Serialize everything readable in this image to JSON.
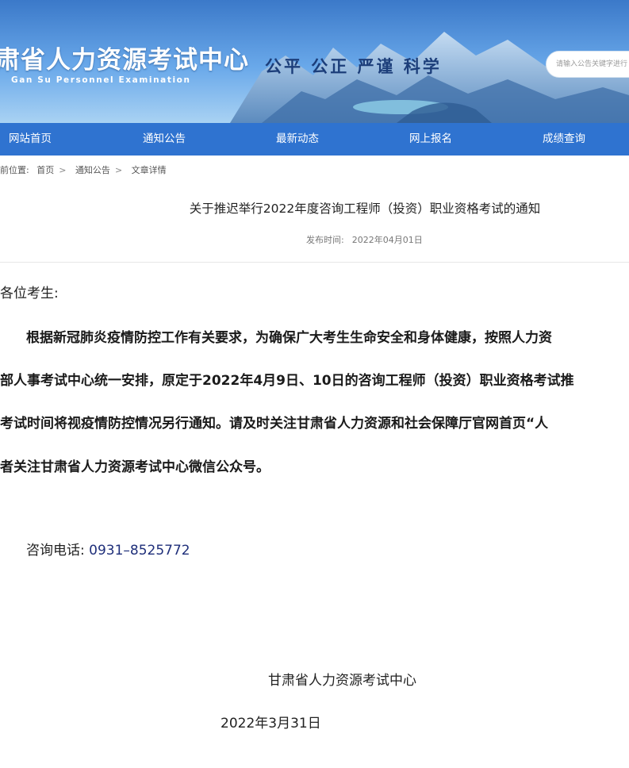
{
  "header": {
    "title": "肃省人力资源考试中心",
    "subtitle": "Gan Su Personnel Examination",
    "slogan": "公平 公正 严谨 科学",
    "search_placeholder": "请输入公告关键字进行"
  },
  "nav": {
    "items": [
      {
        "label": "网站首页"
      },
      {
        "label": "通知公告"
      },
      {
        "label": "最新动态"
      },
      {
        "label": "网上报名"
      },
      {
        "label": "成绩查询"
      }
    ]
  },
  "breadcrumb": {
    "prefix": "前位置:",
    "items": [
      "首页",
      "通知公告",
      "文章详情"
    ]
  },
  "article": {
    "title": "关于推迟举行2022年度咨询工程师（投资）职业资格考试的通知",
    "publish_label": "发布时间:",
    "publish_date": "2022年04月01日",
    "greeting": "各位考生:",
    "lines": [
      "根据新冠肺炎疫情防控工作有关要求，为确保广大考生生命安全和身体健康，按照人力资",
      "部人事考试中心统一安排，原定于2022年4月9日、10日的咨询工程师（投资）职业资格考试推",
      "考试时间将视疫情防控情况另行通知。请及时关注甘肃省人力资源和社会保障厅官网首页“人",
      "者关注甘肃省人力资源考试中心微信公众号。"
    ],
    "phone_label": "咨询电话:",
    "phone_number": "0931–8525772",
    "sign_org": "甘肃省人力资源考试中心",
    "sign_date": "2022年3月31日"
  },
  "colors": {
    "nav_bg": "#2f73d0",
    "banner_sky": "#5b9ee6",
    "slogan": "#1c3e7a",
    "phone_number": "#1f2f7a"
  }
}
